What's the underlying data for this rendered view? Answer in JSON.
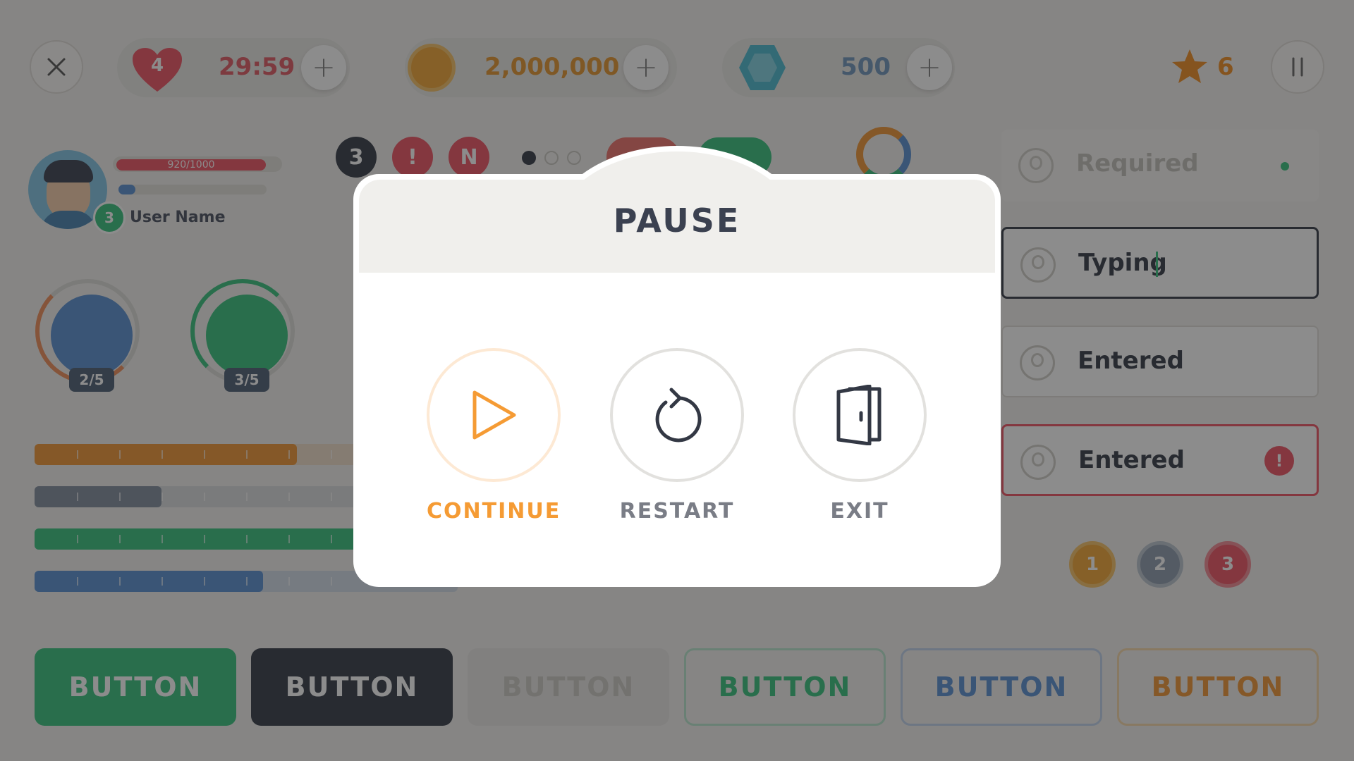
{
  "hud": {
    "lives": "4",
    "timer": "29:59",
    "coins": "2,000,000",
    "gems": "500",
    "stars": "6"
  },
  "profile": {
    "hp": "920/1000",
    "level": "3",
    "name": "User Name"
  },
  "badges": [
    "3",
    "!",
    "N"
  ],
  "skills": [
    {
      "count": "2/5"
    },
    {
      "count": "3/5"
    }
  ],
  "progress_bars": [
    {
      "color": "#f2a149",
      "fraction": 0.62
    },
    {
      "color": "#8e99a8",
      "fraction": 0.3
    },
    {
      "color": "#4cc98b",
      "fraction": 0.9
    },
    {
      "color": "#6b9bd8",
      "fraction": 0.54
    }
  ],
  "inputs": {
    "required": "Required",
    "typing": "Typing",
    "entered": "Entered",
    "entered_error": "Entered"
  },
  "medals": [
    "1",
    "2",
    "3"
  ],
  "buttons": [
    "BUTTON",
    "BUTTON",
    "BUTTON",
    "BUTTON",
    "BUTTON",
    "BUTTON"
  ],
  "pause": {
    "title": "PAUSE",
    "continue": "CONTINUE",
    "restart": "RESTART",
    "exit": "EXIT",
    "accent": "#f59b34"
  }
}
